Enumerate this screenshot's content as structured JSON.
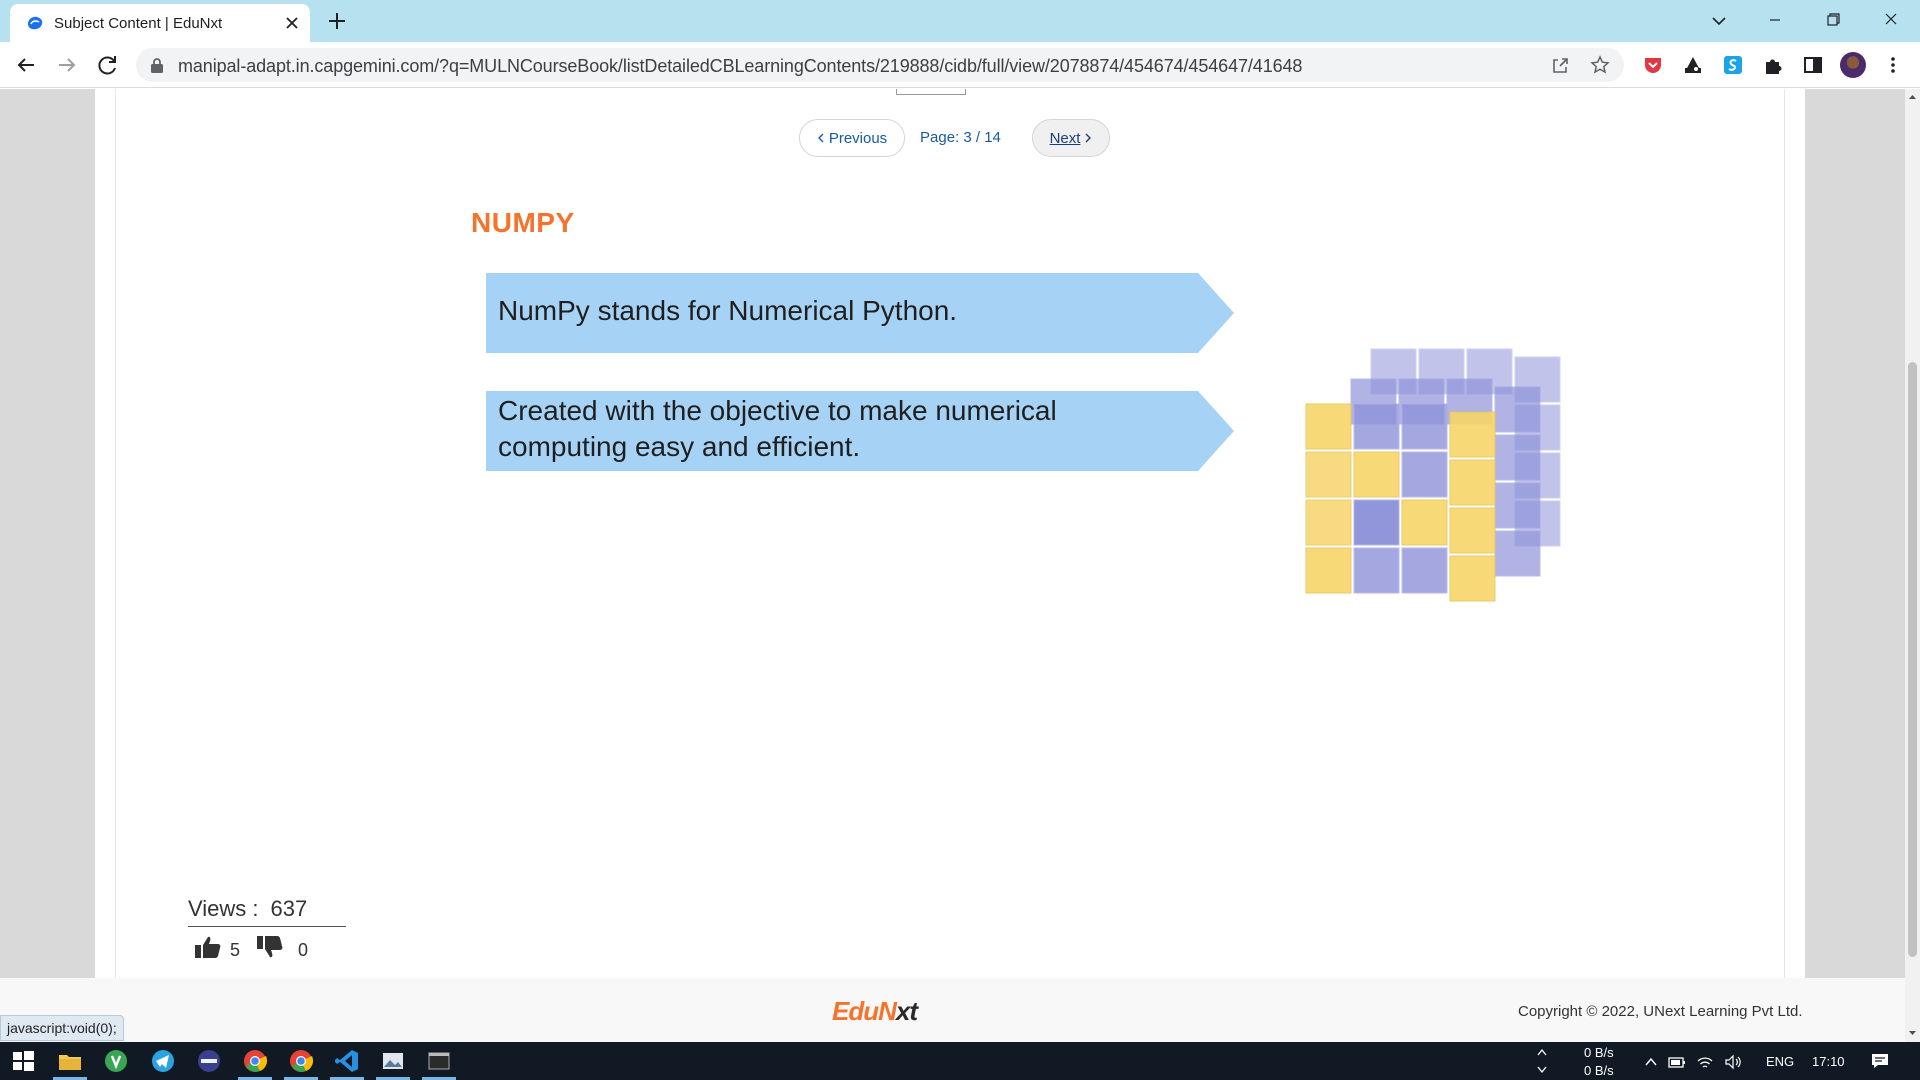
{
  "browser": {
    "tab_title": "Subject Content | EduNxt",
    "url": "manipal-adapt.in.capgemini.com/?q=MULNCourseBook/listDetailedCBLearningContents/219888/cidb/full/view/2078874/454674/454647/41648"
  },
  "pager": {
    "previous_label": "Previous",
    "page_label": "Page: 3 / 14",
    "next_label": "Next"
  },
  "slide": {
    "title": "NUMPY",
    "points": [
      "NumPy stands for Numerical Python.",
      "Created with the objective to make numerical computing easy and efficient."
    ],
    "accent_color": "#f5732a",
    "arrow_color": "#a6d3f5"
  },
  "stats": {
    "views_label": "Views :",
    "views_value": "637",
    "likes": "5",
    "dislikes": "0"
  },
  "footer": {
    "logo_part1": "EduN",
    "logo_part2": "xt",
    "copyright": "Copyright © 2022, UNext Learning Pvt Ltd."
  },
  "status_tooltip": "javascript:void(0);",
  "taskbar": {
    "net_up": "0 B/s",
    "net_down": "0 B/s",
    "language": "ENG",
    "time": "17:10"
  }
}
